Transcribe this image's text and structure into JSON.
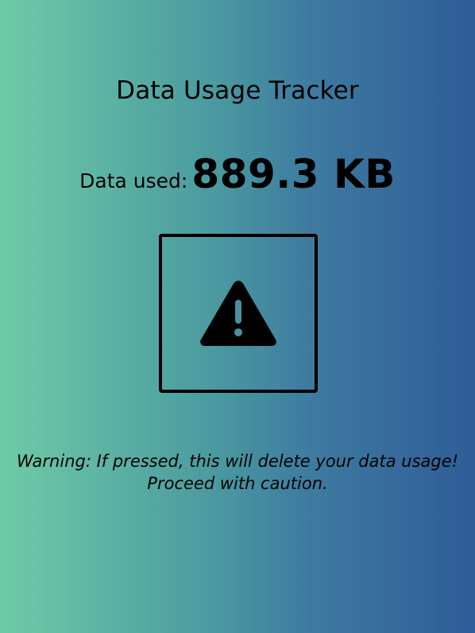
{
  "app": {
    "title": "Data Usage Tracker"
  },
  "usage": {
    "label": "Data used:",
    "value": "889.3 KB"
  },
  "warning_button": {
    "icon": "warning-triangle-icon"
  },
  "warning": {
    "line1": "Warning: If pressed, this will delete your data usage!",
    "line2": "Proceed with caution."
  },
  "colors": {
    "gradient_start": "#6fcba6",
    "gradient_end": "#2f5c98",
    "foreground": "#000000"
  }
}
